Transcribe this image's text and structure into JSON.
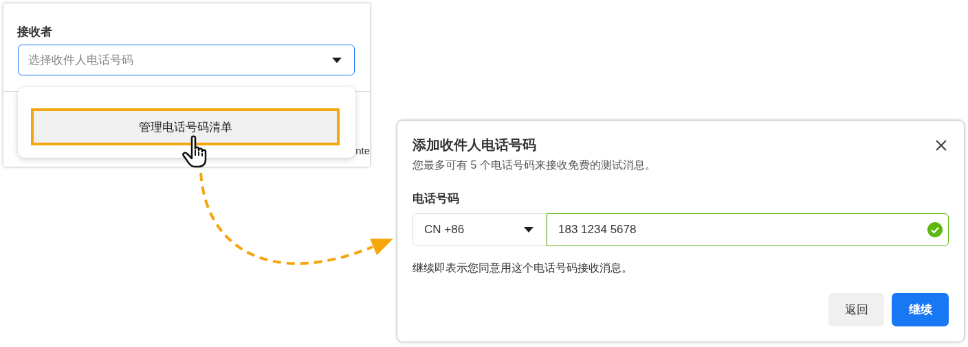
{
  "recipient_panel": {
    "label": "接收者",
    "select": {
      "placeholder": "选择收件人电话号码"
    },
    "menu": {
      "items": [
        {
          "label": "管理电话号码清单",
          "highlighted": true
        }
      ]
    },
    "background_text": "nte"
  },
  "dialog": {
    "title": "添加收件人电话号码",
    "subtitle": "您最多可有 5 个电话号码来接收免费的测试消息。",
    "field_label": "电话号码",
    "country": "CN +86",
    "phone": "183 1234 5678",
    "valid": true,
    "note": "继续即表示您同意用这个电话号码接收消息。",
    "buttons": [
      {
        "label": "返回",
        "kind": "secondary"
      },
      {
        "label": "继续",
        "kind": "primary"
      }
    ]
  }
}
